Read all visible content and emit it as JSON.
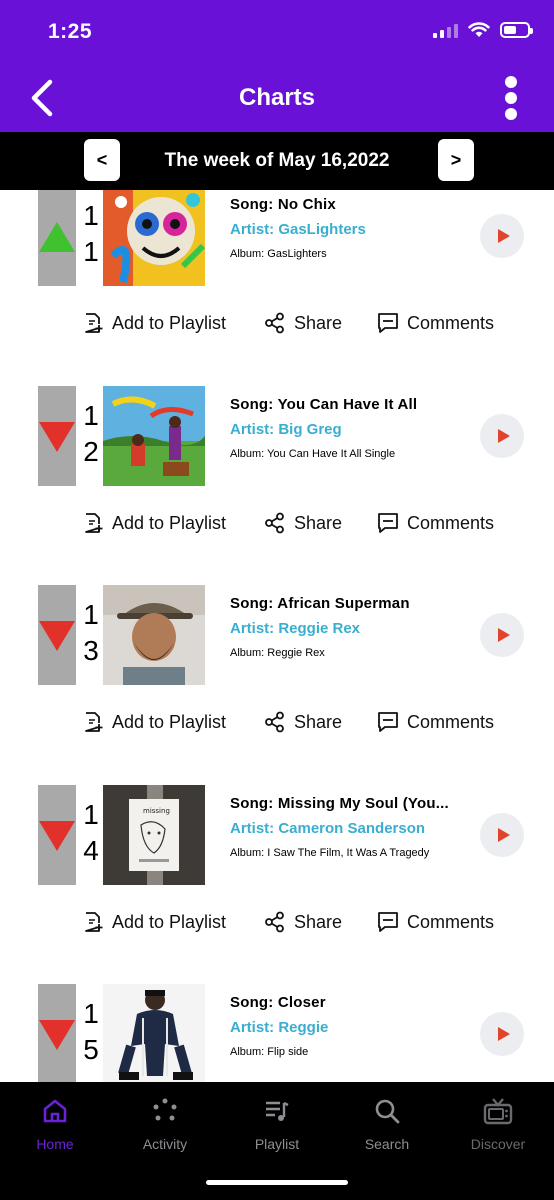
{
  "status_bar": {
    "time": "1:25"
  },
  "header": {
    "title": "Charts"
  },
  "week": {
    "prev_label": "<",
    "label": "The week of May 16,2022",
    "next_label": ">"
  },
  "actions": {
    "add_to_playlist": "Add to Playlist",
    "share": "Share",
    "comments": "Comments"
  },
  "items": [
    {
      "rank_d1": "1",
      "rank_d2": "1",
      "trend": "up",
      "song": "Song: No Chix",
      "artist": "Artist: GasLighters",
      "album": "Album: GasLighters",
      "cover_icon": "skull-artwork"
    },
    {
      "rank_d1": "1",
      "rank_d2": "2",
      "trend": "down",
      "song": "Song: You Can Have It All",
      "artist": "Artist: Big Greg",
      "album": "Album: You Can Have It All Single",
      "cover_icon": "illustrated-artwork"
    },
    {
      "rank_d1": "1",
      "rank_d2": "3",
      "trend": "down",
      "song": "Song: African Superman",
      "artist": "Artist: Reggie Rex",
      "album": "Album: Reggie Rex",
      "cover_icon": "portrait-photo"
    },
    {
      "rank_d1": "1",
      "rank_d2": "4",
      "trend": "down",
      "song": "Song: Missing My Soul (You...",
      "artist": "Artist: Cameron Sanderson",
      "album": "Album: I Saw The Film, It Was A Tragedy",
      "cover_icon": "poster-photo"
    },
    {
      "rank_d1": "1",
      "rank_d2": "5",
      "trend": "down",
      "song": "Song: Closer",
      "artist": "Artist: Reggie",
      "album": "Album: Flip side",
      "cover_icon": "person-photo"
    }
  ],
  "bottom_nav": [
    {
      "label": "Home",
      "icon": "home-icon",
      "state": "active"
    },
    {
      "label": "Activity",
      "icon": "activity-icon",
      "state": "normal"
    },
    {
      "label": "Playlist",
      "icon": "playlist-icon",
      "state": "normal"
    },
    {
      "label": "Search",
      "icon": "search-icon",
      "state": "normal"
    },
    {
      "label": "Discover",
      "icon": "tv-icon",
      "state": "dim"
    }
  ],
  "colors": {
    "brand": "#6a11d8",
    "artist": "#3aaed0",
    "up": "#40c230",
    "down": "#e2302a",
    "play": "#e0452b"
  }
}
